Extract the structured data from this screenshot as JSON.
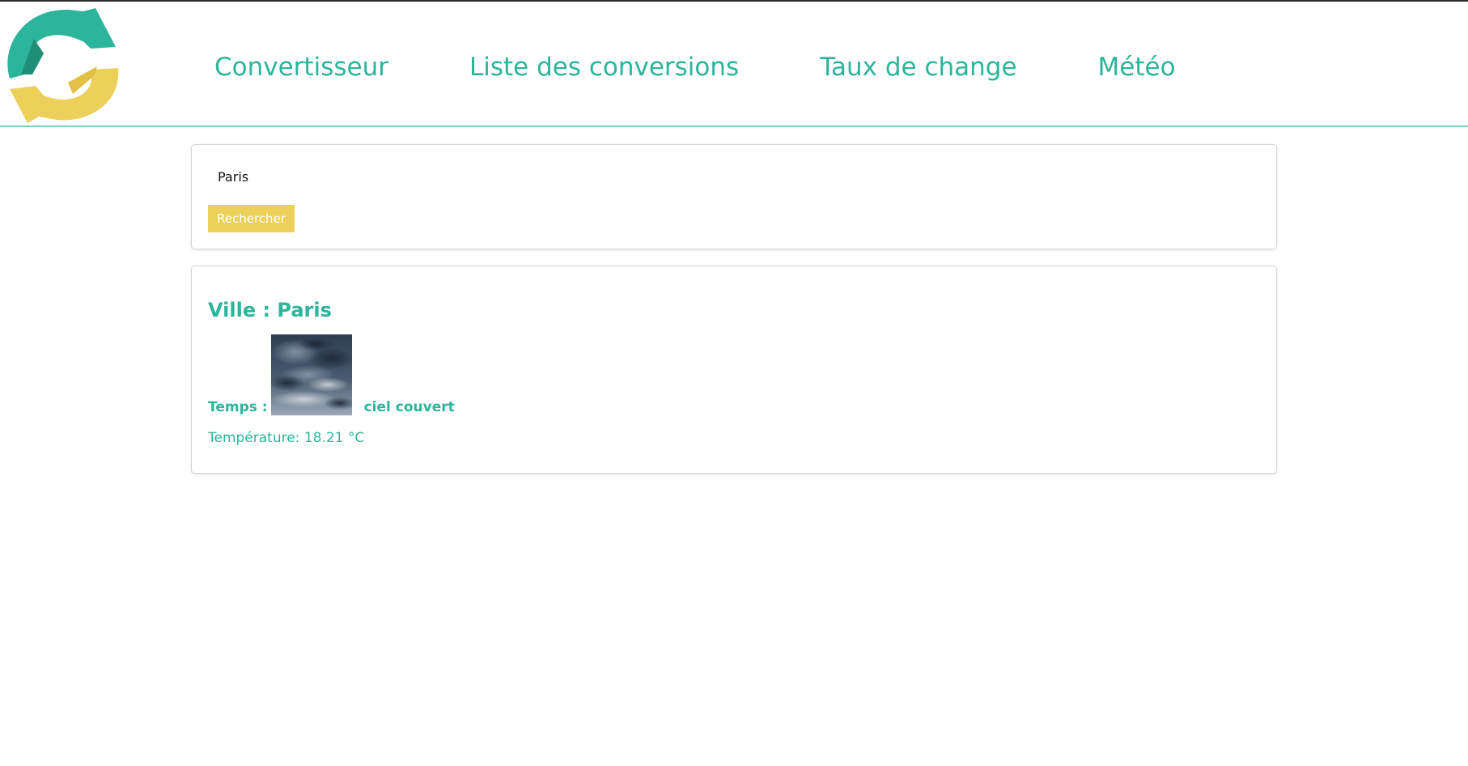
{
  "nav": {
    "links": [
      "Convertisseur",
      "Liste des conversions",
      "Taux de change",
      "Météo"
    ]
  },
  "search": {
    "input_value": "Paris",
    "button_label": "Rechercher"
  },
  "weather": {
    "city_title": "Ville : Paris",
    "temps_label": "Temps :",
    "description": "ciel couvert",
    "temperature_text": "Température: 18.21 °C",
    "image_icon": "overcast-sky-image"
  },
  "colors": {
    "accent": "#2bb59a",
    "button": "#ecd05a",
    "logo_teal": "#2bb59a",
    "logo_yellow": "#ecd05a"
  }
}
